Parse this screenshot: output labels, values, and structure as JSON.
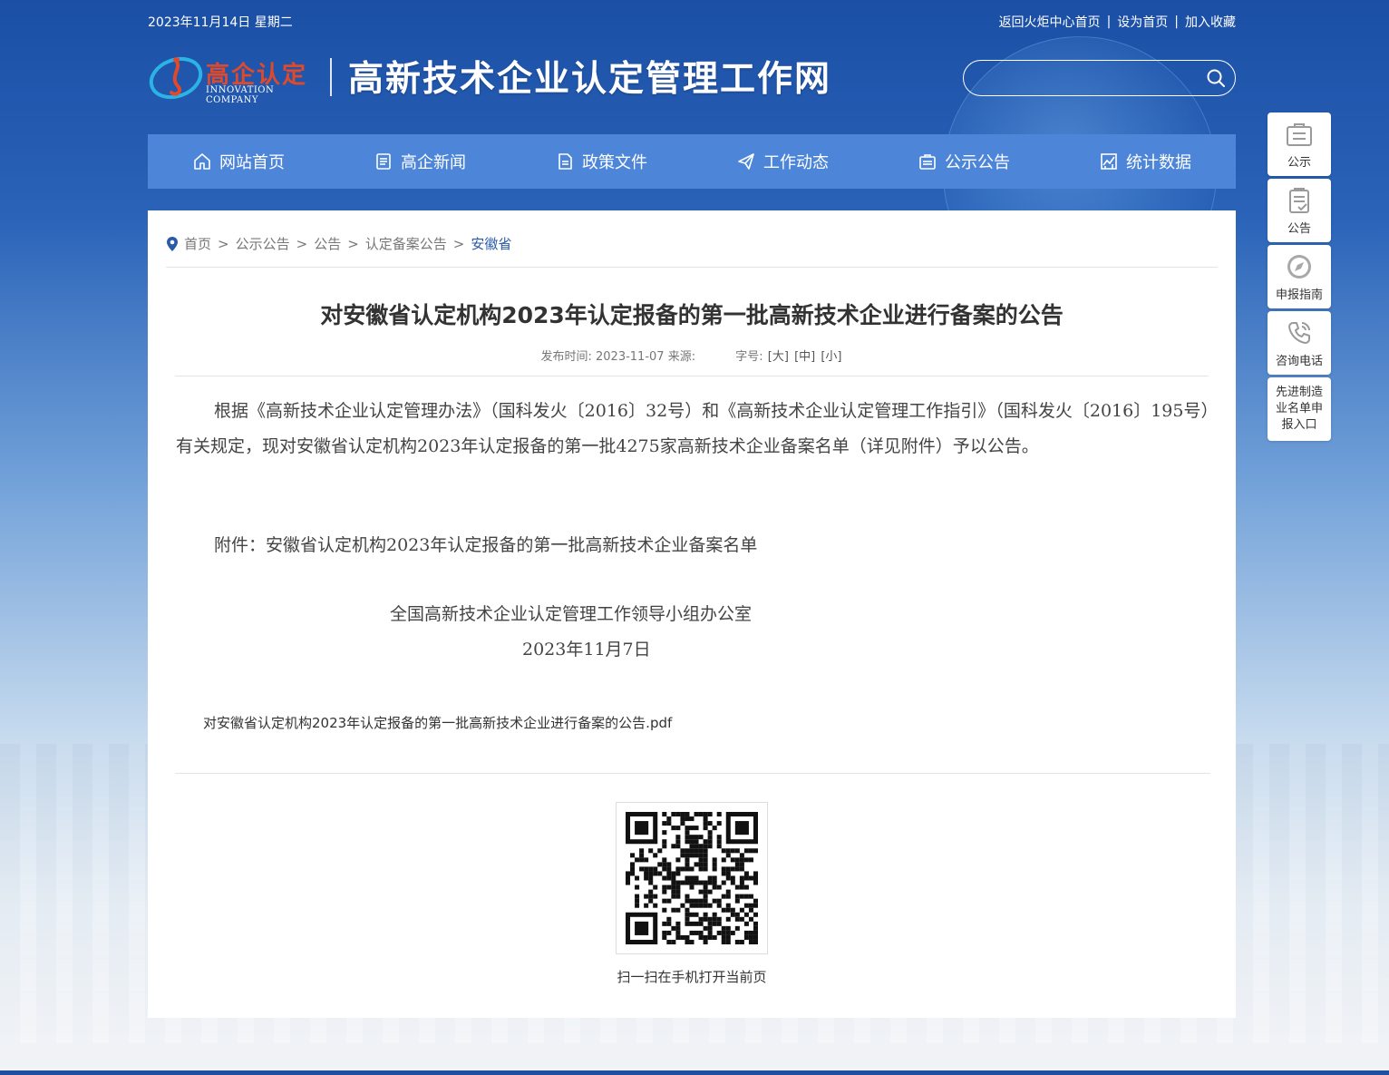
{
  "topbar": {
    "date": "2023年11月14日 星期二",
    "links": [
      "返回火炬中心首页",
      "设为首页",
      "加入收藏"
    ]
  },
  "logo": {
    "cn": "高企认定",
    "en": "INNOVATION COMPANY"
  },
  "site_title": "高新技术企业认定管理工作网",
  "search": {
    "value": "",
    "placeholder": ""
  },
  "nav": [
    {
      "label": "网站首页",
      "icon": "home-icon"
    },
    {
      "label": "高企新闻",
      "icon": "news-icon"
    },
    {
      "label": "政策文件",
      "icon": "document-icon"
    },
    {
      "label": "工作动态",
      "icon": "paper-plane-icon"
    },
    {
      "label": "公示公告",
      "icon": "notice-icon"
    },
    {
      "label": "统计数据",
      "icon": "chart-icon"
    }
  ],
  "breadcrumb": [
    "首页",
    "公示公告",
    "公告",
    "认定备案公告",
    "安徽省"
  ],
  "article": {
    "title": "对安徽省认定机构2023年认定报备的第一批高新技术企业进行备案的公告",
    "meta_time_label": "发布时间:",
    "meta_time": "2023-11-07",
    "meta_source_label": "来源:",
    "font_size_label": "字号:",
    "font_sizes": [
      "[大]",
      "[中]",
      "[小]"
    ],
    "body": "根据《高新技术企业认定管理办法》（国科发火〔2016〕32号）和《高新技术企业认定管理工作指引》（国科发火〔2016〕195号）有关规定，现对安徽省认定机构2023年认定报备的第一批4275家高新技术企业备案名单（详见附件）予以公告。",
    "attachment": "附件：安徽省认定机构2023年认定报备的第一批高新技术企业备案名单",
    "signature": "全国高新技术企业认定管理工作领导小组办公室",
    "date": "2023年11月7日",
    "pdf_link": "对安徽省认定机构2023年认定报备的第一批高新技术企业进行备案的公告.pdf"
  },
  "qr_caption": "扫一扫在手机打开当前页",
  "float_bar": [
    {
      "label": "公示",
      "icon": "briefcase-icon"
    },
    {
      "label": "公告",
      "icon": "clipboard-icon"
    },
    {
      "label": "申报指南",
      "icon": "compass-icon"
    },
    {
      "label": "咨询电话",
      "icon": "phone-icon"
    },
    {
      "label": "先进制造业名单申报入口",
      "lines": [
        "先进制造",
        "业名单申",
        "报入口"
      ]
    }
  ],
  "colors": {
    "nav_bg": "#4d86d9",
    "crumb_current": "#2a5aa8",
    "logo_red": "#e04a2a"
  }
}
